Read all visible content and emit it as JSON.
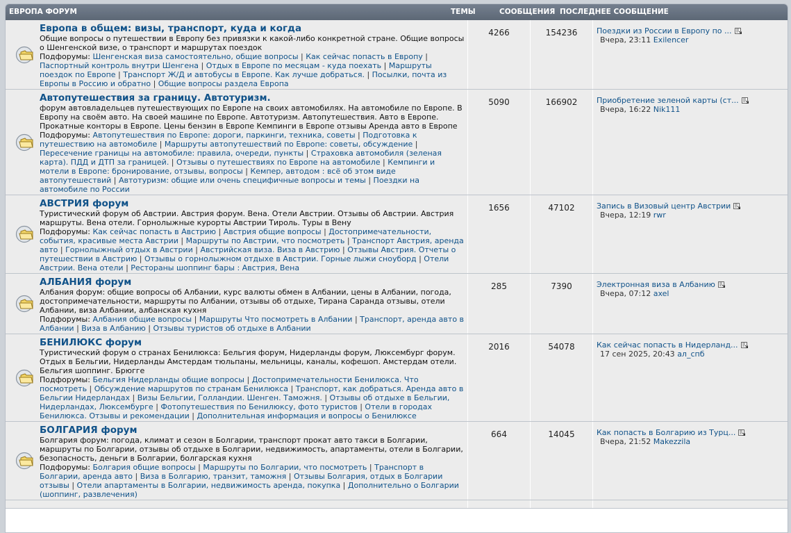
{
  "header": {
    "title": "ЕВРОПА ФОРУМ",
    "topics": "ТЕМЫ",
    "posts": "СООБЩЕНИЯ",
    "last": "ПОСЛЕДНЕЕ СООБЩЕНИЕ"
  },
  "subforums_label": "Подфорумы:",
  "icons": {
    "forum": "forum-folder-icon",
    "goto": "goto-last-post-icon"
  },
  "colors": {
    "header": "#606b79",
    "row": "#ececec",
    "link": "#105289"
  },
  "forums": [
    {
      "title": "Европа в общем: визы, транспорт, куда и когда",
      "desc": "Общие вопросы о путешествии в Европу без привязки к какой-либо конкретной стране. Общие вопросы о Шенгенской визе, о транспорт и маршрутах поездок",
      "subforums": [
        "Шенгенская виза самостоятельно, общие вопросы",
        "Как сейчас попасть в Европу",
        "Паспортный контроль внутри Шенгена",
        "Отдых в Европе по месяцам - куда поехать",
        "Маршруты поездок по Европе",
        "Транспорт Ж/Д и автобусы в Европе. Как лучше добраться.",
        "Посылки, почта из Европы в Россию и обратно",
        "Общие вопросы раздела Европа"
      ],
      "topics": "4266",
      "posts": "154236",
      "last_title": "Поездки из России в Европу по ...",
      "last_time": "Вчера, 23:11",
      "last_user": "Exilencer"
    },
    {
      "title": "Автопутешествия за границу. Автотуризм.",
      "desc": "форум автовладельцев путешествующих по Европе на своих автомобилях. На автомобиле по Европе. В Европу на своём авто. На своей машине по Европе. Автотуризм. Автопутешествия. Авто в Европе. Прокатные конторы в Европе. Цены бензин в Европе Кемпинги в Европе отзывы Аренда авто в Европе",
      "subforums": [
        "Автопутешествия по Европе: дороги, паркинги, техника, советы",
        "Подготовка к путешествию на автомобиле",
        "Маршруты автопутешествий по Европе: советы, обсуждение",
        "Пересечение границы на автомобиле: правила, очереди, пункты",
        "Страховка автомобиля (зеленая карта). ПДД и ДТП за границей.",
        "Отзывы о путешествиях по Европе на автомобиле",
        "Кемпинги и мотели в Европе: бронирование, отзывы, вопросы",
        "Кемпер, автодом : всё об этом виде автопутешествий",
        "Автотуризм: общие или очень специфичные вопросы и темы",
        "Поездки на автомобиле по России"
      ],
      "topics": "5090",
      "posts": "166902",
      "last_title": "Приобретение зеленой карты (ст...",
      "last_time": "Вчера, 16:22",
      "last_user": "Nik111"
    },
    {
      "title": "АВСТРИЯ форум",
      "desc": "Туристический форум об Австрии. Австрия форум. Вена. Отели Австрии. Отзывы об Австрии. Австрия маршруты. Вена отели. Горнолыжные курорты Австрии Тироль. Туры в Вену",
      "subforums": [
        "Как сейчас попасть в Австрию",
        "Австрия общие вопросы",
        "Достопримечательности, события, красивые места Австрии",
        "Маршруты по Австрии, что посмотреть",
        "Транспорт Австрия, аренда авто",
        "Горнолыжный отдых в Австрии",
        "Австрийская виза. Виза в Австрию",
        "Отзывы Австрия. Отчеты о путешествии в Австрию",
        "Отзывы о горнолыжном отдыхе в Австрии. Горные лыжи сноуборд",
        "Отели Австрии. Вена отели",
        "Рестораны шоппинг бары : Австрия, Вена"
      ],
      "topics": "1656",
      "posts": "47102",
      "last_title": "Запись в Визовый центр Австрии",
      "last_time": "Вчера, 12:19",
      "last_user": "rwr"
    },
    {
      "title": "АЛБАНИЯ форум",
      "desc": "Албания форум: общие вопросы об Албании, курс валюты обмен в Албании, цены в Албании, погода, достопримечательности, маршруты по Албании, отзывы об отдыхе, Тирана Саранда отзывы, отели Албании, виза Албании, албанская кухня",
      "subforums": [
        "Албания общие вопросы",
        "Маршруты Что посмотреть в Албании",
        "Транспорт, аренда авто в Албании",
        "Виза в Албанию",
        "Отзывы туристов об отдыхе в Албании"
      ],
      "topics": "285",
      "posts": "7390",
      "last_title": "Электронная виза в Албанию",
      "last_time": "Вчера, 07:12",
      "last_user": "axel"
    },
    {
      "title": "БЕНИЛЮКС форум",
      "desc": "Туристический форум о странах Бенилюкса: Бельгия форум, Нидерланды форум, Люксембург форум. Отдых в Бельгии, Нидерланды Амстердам тюльпаны, мельницы, каналы, кофешоп. Амстердам отели. Бельгия шоппинг. Брюгге",
      "subforums": [
        "Бельгия Нидерланды общие вопросы",
        "Достопримечательности Бенилюкса. Что посмотреть",
        "Обсуждение маршрутов по странам Бенилюкса",
        "Транспорт, как добраться. Аренда авто в Бельгии Нидерландах",
        "Визы Бельгии, Голландии. Шенген. Таможня.",
        "Отзывы об отдыхе в Бельгии, Нидерландах, Люксембурге",
        "Фотопутешествия по Бенилюксу, фото туристов",
        "Отели в городах Бенилюкса. Отзывы и рекомендации",
        "Дополнительная информация и вопросы о Бенилюксе"
      ],
      "topics": "2016",
      "posts": "54078",
      "last_title": "Как сейчас попасть в Нидерланд...",
      "last_time": "17 сен 2025, 20:43",
      "last_user": "ал_спб"
    },
    {
      "title": "БОЛГАРИЯ форум",
      "desc": "Болгария форум: погода, климат и сезон в Болгарии, транспорт прокат авто такси в Болгарии, маршруты по Болгарии, отзывы об отдыхе в Болгарии, недвижимость, апартаменты, отели в Болгарии, безопасность, деньги в Болгарии, болгарская кухня",
      "subforums": [
        "Болгария общие вопросы",
        "Маршруты по Болгарии, что посмотреть",
        "Транспорт в Болгарии, аренда авто",
        "Виза в Болгарию, транзит, таможня",
        "Отзывы Болгария, отдых в Болгарии отзывы",
        "Отели апартаменты в Болгарии, недвижимость аренда, покупка",
        "Дополнительно о Болгарии (шоппинг, развлечения)"
      ],
      "topics": "664",
      "posts": "14045",
      "last_title": "Как попасть в Болгарию из Турц...",
      "last_time": "Вчера, 21:52",
      "last_user": "Makezzila"
    },
    {
      "title": "",
      "desc": "",
      "subforums": [],
      "topics": "",
      "posts": "",
      "last_title": "",
      "last_time": "",
      "last_user": ""
    }
  ]
}
